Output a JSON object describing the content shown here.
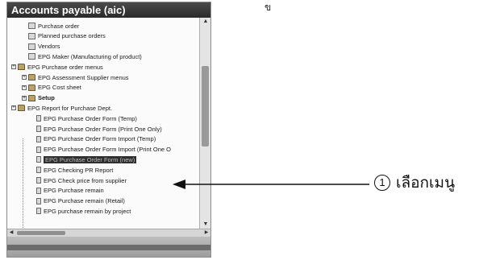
{
  "panel": {
    "title": "Accounts payable (aic)",
    "items": [
      {
        "label": "Purchase order",
        "indent": 1,
        "kind": "doc"
      },
      {
        "label": "Planned purchase orders",
        "indent": 1,
        "kind": "doc"
      },
      {
        "label": "Vendors",
        "indent": 1,
        "kind": "doc"
      },
      {
        "label": "EPG Maker (Manufacturing of product)",
        "indent": 1,
        "kind": "doc"
      },
      {
        "label": "EPG Purchase order menus",
        "indent": 0,
        "kind": "folder",
        "expander": "+"
      },
      {
        "label": "EPG Assessment Supplier menus",
        "indent": 1,
        "kind": "folder",
        "expander": "+"
      },
      {
        "label": "EPG Cost sheet",
        "indent": 1,
        "kind": "folder",
        "expander": "+"
      },
      {
        "label": "Setup",
        "indent": 1,
        "kind": "folder",
        "expander": "+",
        "bold": true
      },
      {
        "label": "EPG Report for Purchase Dept.",
        "indent": 0,
        "kind": "folder",
        "expander": "+"
      },
      {
        "label": "EPG Purchase Order Form (Temp)",
        "indent": 2,
        "kind": "doc"
      },
      {
        "label": "EPG Purchase Order Form (Print One Only)",
        "indent": 2,
        "kind": "doc"
      },
      {
        "label": "EPG Purchase Order Form Import (Temp)",
        "indent": 2,
        "kind": "doc"
      },
      {
        "label": "EPG Purchase Order Form Import (Print One O",
        "indent": 2,
        "kind": "doc"
      },
      {
        "label": "EPG Purchase Order Form (new)",
        "indent": 2,
        "kind": "doc",
        "selected": true
      },
      {
        "label": "EPG Checking PR Report",
        "indent": 2,
        "kind": "doc"
      },
      {
        "label": "EPG Check price from supplier",
        "indent": 2,
        "kind": "doc"
      },
      {
        "label": "EPG Purchase remain",
        "indent": 2,
        "kind": "doc"
      },
      {
        "label": "EPG Purchase remain (Retail)",
        "indent": 2,
        "kind": "doc"
      },
      {
        "label": "EPG purchase remain by project",
        "indent": 2,
        "kind": "doc"
      }
    ]
  },
  "top_mark": "ข",
  "callout": {
    "number": "1",
    "text": "เลือกเมนู"
  }
}
